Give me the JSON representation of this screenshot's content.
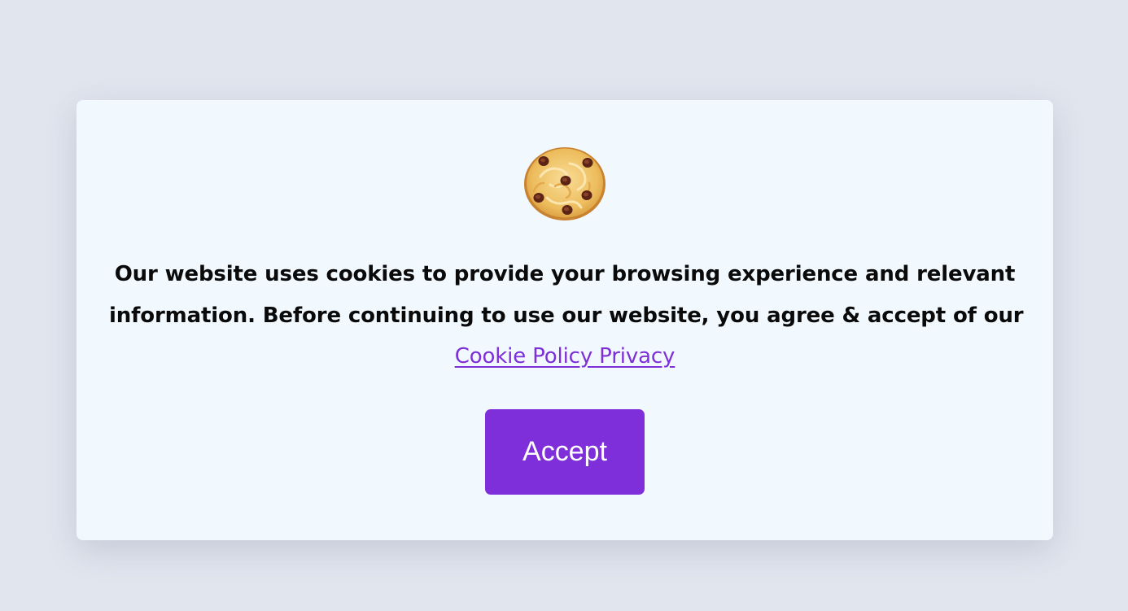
{
  "banner": {
    "icon": "cookie-icon",
    "message_line1": "Our website uses cookies to provide your browsing experience and relevant",
    "message_line2": "information. Before continuing to use our website, you agree & accept of our",
    "policy_link_text": "Cookie Policy Privacy",
    "accept_label": "Accept"
  },
  "colors": {
    "page_background": "#e1e5ee",
    "card_background": "#f1f8fe",
    "accent": "#7e2fd9",
    "text": "#0a0a0a"
  }
}
